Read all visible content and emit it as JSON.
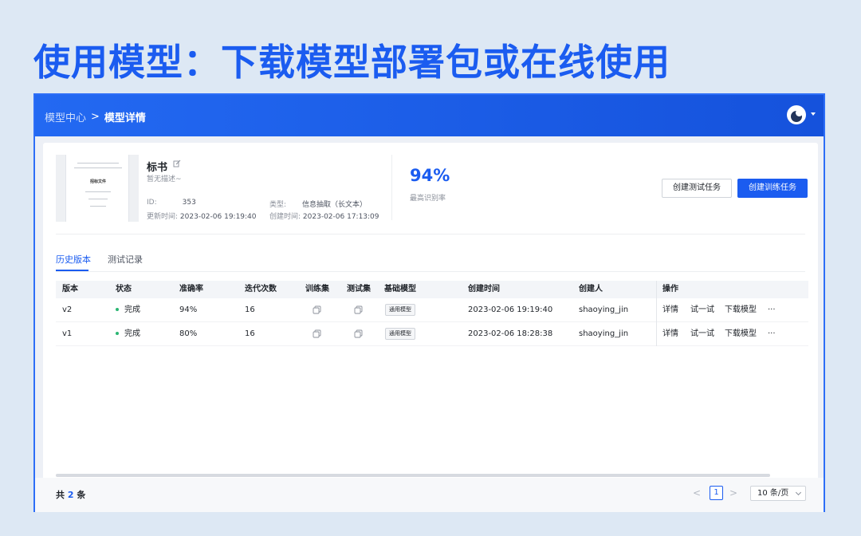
{
  "slide_title": "使用模型：下载模型部署包或在线使用",
  "breadcrumb": {
    "root": "模型中心",
    "separator": ">",
    "current": "模型详情"
  },
  "model": {
    "thumb_heading": "招标文件",
    "name": "标书",
    "description": "暂无描述~",
    "id_label": "ID:",
    "id_value": "353",
    "type_label": "类型:",
    "type_value": "信息抽取（长文本）",
    "updated_label": "更新时间:",
    "updated_value": "2023-02-06 19:19:40",
    "created_label": "创建时间:",
    "created_value": "2023-02-06 17:13:09",
    "metric_value": "94%",
    "metric_label": "最高识别率"
  },
  "actions": {
    "create_test": "创建测试任务",
    "create_train": "创建训练任务"
  },
  "tabs": [
    {
      "label": "历史版本",
      "active": true
    },
    {
      "label": "测试记录",
      "active": false
    }
  ],
  "table": {
    "headers": [
      "版本",
      "状态",
      "准确率",
      "迭代次数",
      "训练集",
      "测试集",
      "基础模型",
      "创建时间",
      "创建人",
      "操作"
    ],
    "rows": [
      {
        "version": "v2",
        "status": "完成",
        "accuracy": "94%",
        "iterations": "16",
        "base_model": "通用模型",
        "created_at": "2023-02-06 19:19:40",
        "creator": "shaoying_jin",
        "ops": [
          "详情",
          "试一试",
          "下载模型"
        ],
        "more": "···"
      },
      {
        "version": "v1",
        "status": "完成",
        "accuracy": "80%",
        "iterations": "16",
        "base_model": "通用模型",
        "created_at": "2023-02-06 18:28:38",
        "creator": "shaoying_jin",
        "ops": [
          "详情",
          "试一试",
          "下载模型"
        ],
        "more": "···"
      }
    ]
  },
  "pagination": {
    "total_prefix": "共",
    "total_count": "2",
    "total_suffix": "条",
    "prev": "<",
    "current_page": "1",
    "next": ">",
    "page_size": "10 条/页"
  },
  "colors": {
    "brand": "#1b5cf0",
    "header_bg": "#1552dc",
    "status_done": "#2bb673",
    "background": "#dde8f4"
  }
}
